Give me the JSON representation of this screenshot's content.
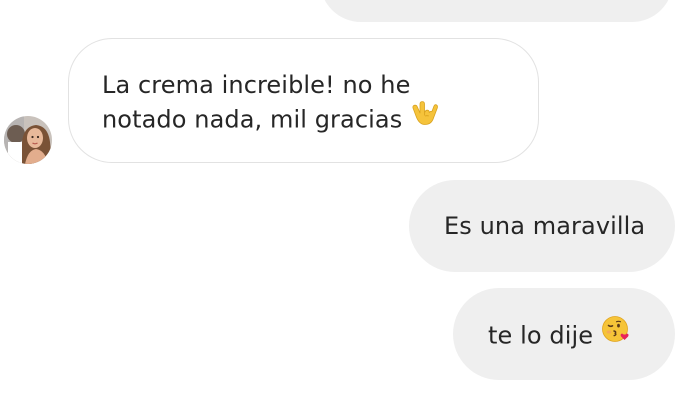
{
  "conversation": {
    "previous_sent": {
      "text": ""
    },
    "received": {
      "line1": "La crema increible! no he",
      "line2": "notado nada, mil gracias",
      "emoji": "rock-on-hand-emoji"
    },
    "sent": [
      {
        "text": "Es una maravilla"
      },
      {
        "text": "te lo dije",
        "emoji": "face-blowing-kiss-emoji"
      }
    ]
  },
  "contact": {
    "avatar": "contact-avatar-photo"
  },
  "colors": {
    "sent_bubble": "#efefef",
    "received_bubble_border": "#e2e2e2",
    "text": "#262626",
    "background": "#ffffff"
  }
}
